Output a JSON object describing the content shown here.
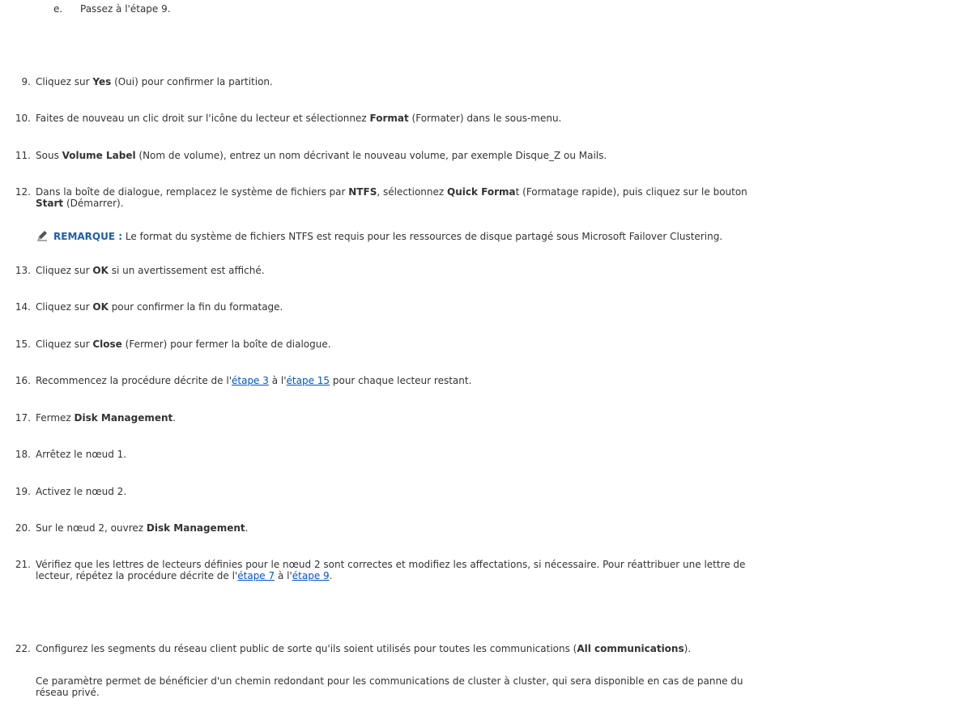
{
  "substep_e": {
    "letter": "e.",
    "text": "Passez à l'étape 9."
  },
  "steps": [
    {
      "num": "9.",
      "pre": "Cliquez sur ",
      "b1": "Yes",
      "post": " (Oui) pour confirmer la partition."
    },
    {
      "num": "10.",
      "pre": "Faites de nouveau un clic droit sur l'icône du lecteur et sélectionnez ",
      "b1": "Format",
      "post": " (Formater) dans le sous-menu."
    },
    {
      "num": "11.",
      "pre": "Sous ",
      "b1": "Volume Label",
      "post": " (Nom de volume), entrez un nom décrivant le nouveau volume, par exemple Disque_Z ou Mails."
    },
    {
      "num": "12.",
      "pre": "Dans la boîte de dialogue, remplacez le système de fichiers par ",
      "b1": "NTFS",
      "mid": ", sélectionnez ",
      "b2": "Quick Forma",
      "mid2": "t (Formatage rapide), puis cliquez sur le bouton",
      "line2_b": "Start",
      "line2_post": " (Démarrer)."
    },
    {
      "num": "13.",
      "pre": "Cliquez sur ",
      "b1": "OK",
      "post": " si un avertissement est affiché."
    },
    {
      "num": "14.",
      "pre": "Cliquez sur ",
      "b1": "OK",
      "post": " pour confirmer la fin du formatage."
    },
    {
      "num": "15.",
      "pre": "Cliquez sur ",
      "b1": "Close",
      "post": " (Fermer) pour fermer la boîte de dialogue."
    },
    {
      "num": "16.",
      "pre": "Recommencez la procédure décrite de l'",
      "link1": "étape 3",
      "mid": " à l'",
      "link2": "étape 15",
      "post": " pour chaque lecteur restant."
    },
    {
      "num": "17.",
      "pre": "Fermez ",
      "b1": "Disk Management",
      "post": "."
    },
    {
      "num": "18.",
      "pre": "Arrêtez le nœud 1.",
      "b1": "",
      "post": ""
    },
    {
      "num": "19.",
      "pre": "Activez le nœud 2.",
      "b1": "",
      "post": ""
    },
    {
      "num": "20.",
      "pre": "Sur le nœud 2, ouvrez ",
      "b1": "Disk Management",
      "post": "."
    },
    {
      "num": "21.",
      "line1": "Vérifiez que les lettres de lecteurs définies pour le nœud 2 sont correctes et modifiez les affectations, si nécessaire. Pour réattribuer une lettre de",
      "line2_pre": "lecteur, répétez la procédure décrite de l'",
      "link1": "étape 7",
      "mid": " à l'",
      "link2": "étape 9",
      "post": "."
    },
    {
      "num": "22.",
      "pre": "Configurez les segments du réseau client public de sorte qu'ils soient utilisés pour toutes les communications (",
      "b1": "All communications",
      "post": ")."
    }
  ],
  "note": {
    "icon": "note-pencil-icon",
    "label": "REMARQUE :",
    "text": " Le format du système de fichiers NTFS est requis pour les ressources de disque partagé sous Microsoft Failover Clustering."
  },
  "final_paragraph": {
    "line1": "Ce paramètre permet de bénéficier d'un chemin redondant pour les communications de cluster à cluster, qui sera disponible en cas de panne du",
    "line2": "réseau privé."
  },
  "colors": {
    "text": "#333333",
    "link": "#0055cc",
    "note_label": "#1f5fa8"
  }
}
